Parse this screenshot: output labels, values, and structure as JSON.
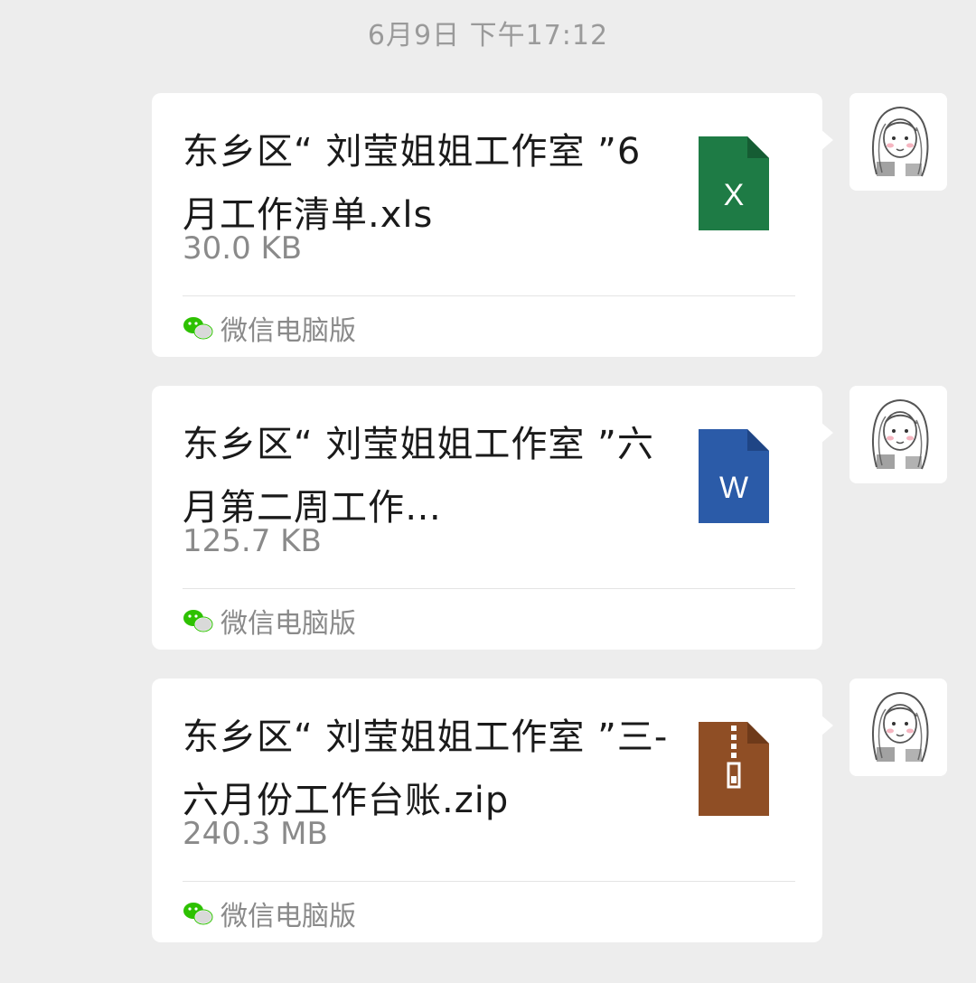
{
  "chat": {
    "timestamp": "6月9日 下午17:12"
  },
  "messages": [
    {
      "file_name": "东乡区“ 刘莹姐姐工作室 ”6 月工作清单.xls",
      "file_size": "30.0 KB",
      "file_type": "excel",
      "icon_name": "excel-file-icon",
      "icon_color": "#1e7b45",
      "icon_letter": "X",
      "source": "微信电脑版"
    },
    {
      "file_name": "东乡区“ 刘莹姐姐工作室 ”六月第二周工作…",
      "file_size": "125.7 KB",
      "file_type": "word",
      "icon_name": "word-file-icon",
      "icon_color": "#2b5ba8",
      "icon_letter": "W",
      "source": "微信电脑版"
    },
    {
      "file_name": "东乡区“ 刘莹姐姐工作室 ”三-六月份工作台账.zip",
      "file_size": "240.3 MB",
      "file_type": "zip",
      "icon_name": "zip-file-icon",
      "icon_color": "#8f4e25",
      "icon_letter": "",
      "source": "微信电脑版"
    }
  ],
  "colors": {
    "background": "#ededed",
    "bubble": "#ffffff",
    "wechat_green": "#2dc100"
  }
}
